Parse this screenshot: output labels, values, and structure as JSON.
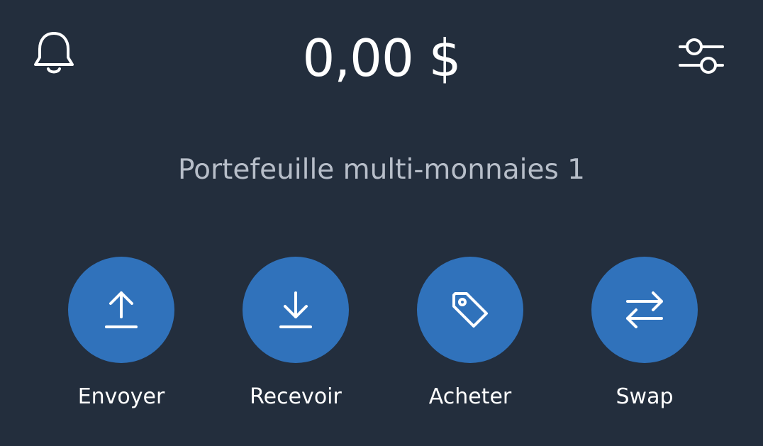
{
  "header": {
    "balance": "0,00 $",
    "notifications_icon": "bell-icon",
    "settings_icon": "sliders-icon"
  },
  "wallet": {
    "name": "Portefeuille multi-monnaies 1"
  },
  "actions": [
    {
      "label": "Envoyer",
      "icon": "upload-icon"
    },
    {
      "label": "Recevoir",
      "icon": "download-icon"
    },
    {
      "label": "Acheter",
      "icon": "tag-icon"
    },
    {
      "label": "Swap",
      "icon": "swap-arrows-icon"
    }
  ],
  "colors": {
    "background": "#232e3d",
    "accent": "#3072bb",
    "text_primary": "#ffffff",
    "text_secondary": "#b7bec9"
  }
}
